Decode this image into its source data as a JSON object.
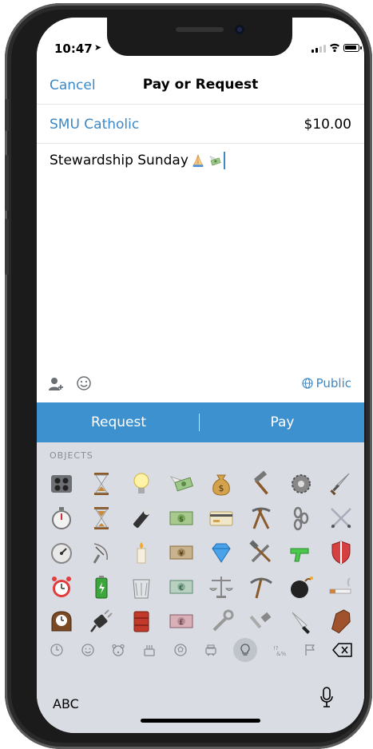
{
  "status": {
    "time": "10:47"
  },
  "nav": {
    "cancel": "Cancel",
    "title": "Pay or Request"
  },
  "recipient": {
    "name": "SMU Catholic",
    "amount": "$10.00"
  },
  "note": {
    "text": "Stewardship Sunday "
  },
  "options": {
    "privacy": "Public"
  },
  "actions": {
    "request": "Request",
    "pay": "Pay"
  },
  "keyboard": {
    "category": "OBJECTS",
    "abc": "ABC",
    "emoji_grid": [
      "radio",
      "hourglass",
      "light-bulb",
      "money-with-wings",
      "money-bag",
      "hammer",
      "gear",
      "dagger",
      "stopwatch",
      "hourglass-flowing",
      "flashlight",
      "dollar-banknote",
      "credit-card",
      "hammer-and-pick",
      "chains",
      "crossed-swords",
      "timer-clock",
      "satellite-antenna",
      "candle",
      "yen-banknote",
      "gem-stone",
      "hammer-and-wrench",
      "water-pistol",
      "shield",
      "alarm-clock",
      "battery",
      "wastebasket",
      "euro-banknote",
      "balance-scale",
      "pick",
      "bomb",
      "cigarette",
      "mantelpiece-clock",
      "electric-plug",
      "oil-drum",
      "pound-banknote",
      "wrench",
      "nut-and-bolt",
      "kitchen-knife",
      "coffin"
    ],
    "categories": [
      "clock-icon",
      "smiley-icon",
      "bear-icon",
      "food-icon",
      "ball-icon",
      "car-icon",
      "bulb-icon",
      "symbols-icon",
      "flag-icon",
      "backspace-icon"
    ],
    "selected_category": "bulb-icon"
  },
  "colors": {
    "accent": "#3c88c6",
    "action_bar": "#3e91cf"
  }
}
